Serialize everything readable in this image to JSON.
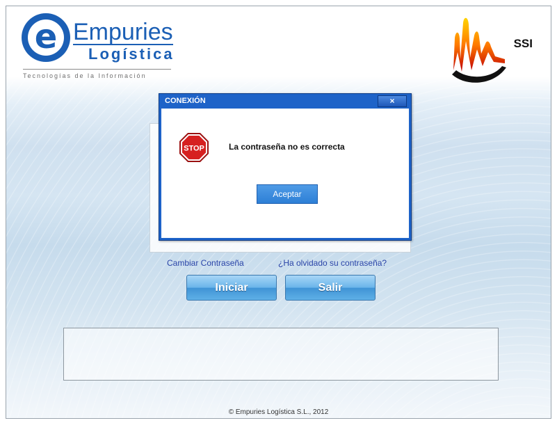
{
  "branding": {
    "logo_letter": "e",
    "company_name": "Empuries",
    "company_sub": "Logística",
    "tagline": "Tecnologías de la Información",
    "partner_name": "SSI"
  },
  "login": {
    "change_password_link": "Cambiar Contraseña",
    "forgot_password_link": "¿Ha olvidado su contraseña?",
    "start_button": "Iniciar",
    "exit_button": "Salir"
  },
  "footer": {
    "copyright": "© Empuries Logística S.L., 2012"
  },
  "dialog": {
    "title": "CONEXIÓN",
    "close_label": "×",
    "stop_label": "STOP",
    "message": "La contraseña no es correcta",
    "ok_button": "Aceptar"
  },
  "colors": {
    "brand_blue": "#1b5fb5",
    "dialog_blue": "#1e63c8",
    "stop_red": "#d62020"
  }
}
